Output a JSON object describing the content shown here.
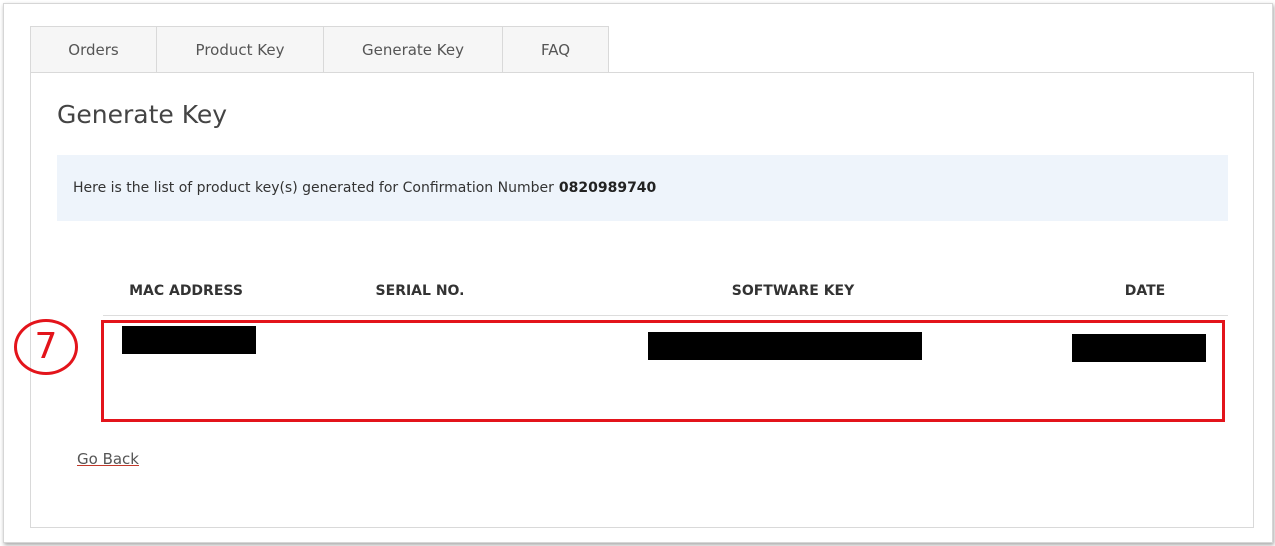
{
  "tabs": [
    {
      "label": "Orders"
    },
    {
      "label": "Product Key"
    },
    {
      "label": "Generate Key"
    },
    {
      "label": "FAQ"
    }
  ],
  "page": {
    "title": "Generate Key"
  },
  "info": {
    "text": "Here is the list of product key(s) generated for Confirmation Number",
    "confirmation_number": "0820989740"
  },
  "table": {
    "headers": [
      "MAC ADDRESS",
      "SERIAL NO.",
      "SOFTWARE KEY",
      "DATE"
    ],
    "rows": [
      {
        "mac_address": "[redacted]",
        "serial_no": "",
        "software_key": "[redacted]",
        "date": "[redacted]"
      }
    ]
  },
  "annotation": {
    "step_number": "7",
    "color": "#e3141b"
  },
  "links": {
    "go_back": "Go Back"
  },
  "colors": {
    "info_bg": "#eef4fb",
    "highlight": "#e3141b",
    "tab_bg": "#f6f6f6"
  }
}
